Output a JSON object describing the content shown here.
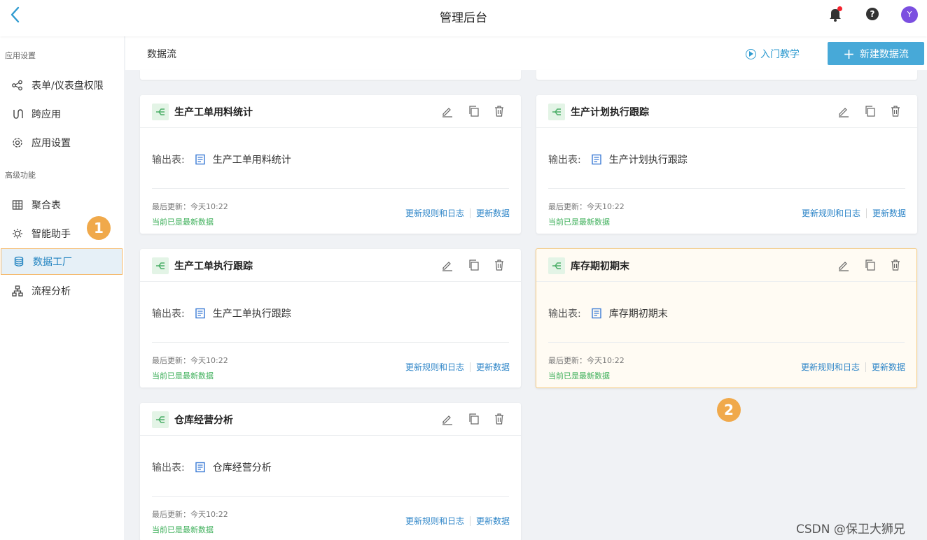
{
  "header": {
    "title": "管理后台",
    "avatar_text": "Y",
    "help_text": "?"
  },
  "sidebar": {
    "section_app": "应用设置",
    "section_advanced": "高级功能",
    "items": [
      {
        "label": "表单/仪表盘权限",
        "icon": "share-nodes-icon"
      },
      {
        "label": "跨应用",
        "icon": "cross-app-icon"
      },
      {
        "label": "应用设置",
        "icon": "gear-icon"
      },
      {
        "label": "聚合表",
        "icon": "table-icon"
      },
      {
        "label": "智能助手",
        "icon": "bulb-icon"
      },
      {
        "label": "数据工厂",
        "icon": "database-icon",
        "active": true
      },
      {
        "label": "流程分析",
        "icon": "org-chart-icon"
      }
    ]
  },
  "annotations": {
    "one": "1",
    "two": "2"
  },
  "content": {
    "breadcrumb": "数据流",
    "guide_label": "入门教学",
    "new_button_label": "新建数据流",
    "card_common": {
      "output_label": "输出表:",
      "last_update": "最后更新：今天10:22",
      "status": "当前已是最新数据",
      "rules_link": "更新规则和日志",
      "update_link": "更新数据"
    },
    "cards": [
      {
        "name": "生产工单用料统计",
        "output": "生产工单用料统计"
      },
      {
        "name": "生产计划执行跟踪",
        "output": "生产计划执行跟踪"
      },
      {
        "name": "生产工单执行跟踪",
        "output": "生产工单执行跟踪"
      },
      {
        "name": "库存期初期末",
        "output": "库存期初期末",
        "highlighted": true
      },
      {
        "name": "仓库经营分析",
        "output": "仓库经营分析"
      }
    ]
  },
  "watermark": "CSDN @保卫大狮兄",
  "colors": {
    "accent": "#47a9d8",
    "link": "#2f86c8",
    "ok": "#3fb05b",
    "badge": "#f0a94b"
  }
}
